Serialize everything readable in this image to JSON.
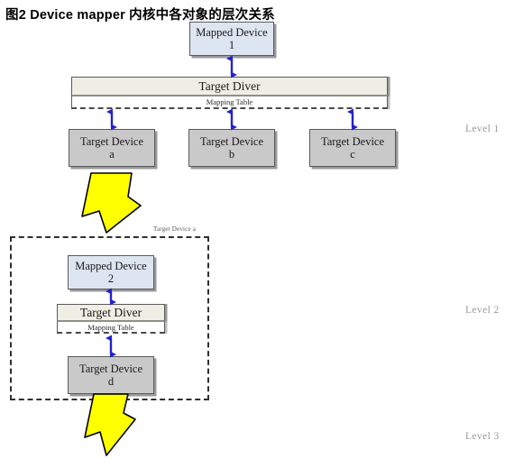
{
  "title": "图2 Device mapper 内核中各对象的层次关系",
  "colors": {
    "mapped_device_fill": "#dde5f1",
    "target_device_fill": "#c9c9c9",
    "target_driver_fill": "#eeeee4",
    "mapping_table_fill": "#ffffff",
    "arrow_blue": "#2222cc",
    "arrow_yellow": "#ffff00",
    "box_border": "#5a5a5a",
    "region_dash": "#2f2f2f",
    "level_label": "#9a9a9a"
  },
  "level1": {
    "label": "Level 1",
    "mapped_device": {
      "line1": "Mapped Device",
      "line2": "1"
    },
    "target_driver": {
      "name": "Target  Diver",
      "mapping_table": "Mapping Table"
    },
    "target_devices": [
      {
        "line1": "Target Device",
        "line2": "a"
      },
      {
        "line1": "Target Device",
        "line2": "b"
      },
      {
        "line1": "Target Device",
        "line2": "c"
      }
    ]
  },
  "level2": {
    "label": "Level 2",
    "region_label": "Target Device a",
    "mapped_device": {
      "line1": "Mapped Device",
      "line2": "2"
    },
    "target_driver": {
      "name": "Target  Diver",
      "mapping_table": "Mapping Table"
    },
    "target_devices": [
      {
        "line1": "Target Device",
        "line2": "d"
      }
    ]
  },
  "level3": {
    "label": "Level 3"
  },
  "icons": {
    "vertical_double_arrow": "double-headed-vertical-arrow",
    "yellow_arrow": "yellow-block-arrow-down"
  }
}
